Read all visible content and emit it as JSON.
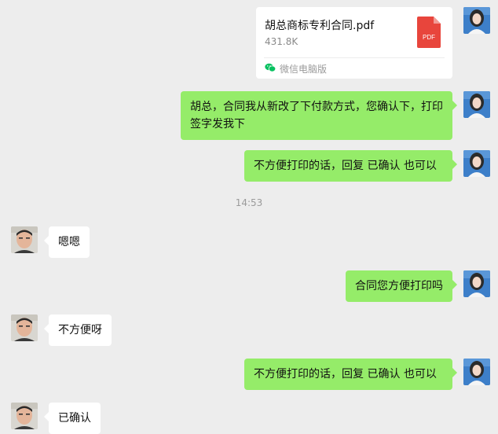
{
  "file_card": {
    "name": "胡总商标专利合同.pdf",
    "size": "431.8K",
    "source": "微信电脑版",
    "icon": "pdf-file-icon",
    "icon_label": "PDF",
    "icon_color": "#e8453c"
  },
  "messages": [
    {
      "text": "胡总，合同我从新改了下付款方式，您确认下，打印签字发我下",
      "from": "me"
    },
    {
      "text": "不方便打印的话，回复  已确认  也可以",
      "from": "me"
    },
    {
      "text": "嗯嗯",
      "from": "them"
    },
    {
      "text": "合同您方便打印吗",
      "from": "me"
    },
    {
      "text": "不方便呀",
      "from": "them"
    },
    {
      "text": "不方便打印的话，回复  已确认  也可以",
      "from": "me"
    },
    {
      "text": "已确认",
      "from": "them"
    }
  ],
  "timestamp": "14:53",
  "colors": {
    "background": "#ededed",
    "my_bubble": "#95ec69",
    "their_bubble": "#ffffff",
    "pdf_red": "#e8453c",
    "wechat_green": "#07c160"
  }
}
